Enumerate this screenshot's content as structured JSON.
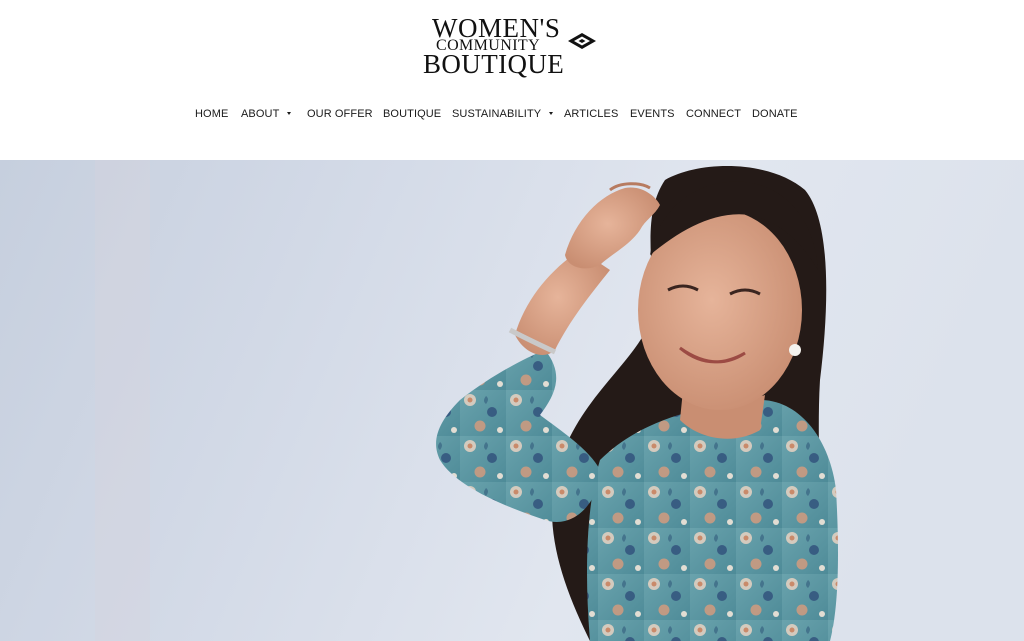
{
  "logo": {
    "line1": "WOMEN'S",
    "line2": "COMMUNITY",
    "line3": "BOUTIQUE",
    "icon": "diamond-logo-icon"
  },
  "nav": {
    "items": [
      {
        "label": "HOME",
        "has_dropdown": false
      },
      {
        "label": "ABOUT",
        "has_dropdown": true
      },
      {
        "label": "OUR OFFER",
        "has_dropdown": false
      },
      {
        "label": "BOUTIQUE",
        "has_dropdown": false
      },
      {
        "label": "SUSTAINABILITY",
        "has_dropdown": true
      },
      {
        "label": "ARTICLES",
        "has_dropdown": false
      },
      {
        "label": "EVENTS",
        "has_dropdown": false
      },
      {
        "label": "CONNECT",
        "has_dropdown": false
      },
      {
        "label": "DONATE",
        "has_dropdown": false
      }
    ]
  },
  "hero": {
    "icon": "hero-photo-smiling-woman"
  },
  "colors": {
    "text": "#1a1a1a",
    "background": "#ffffff",
    "hero_backdrop": "#dde3ee",
    "blouse": "#5f9aa6"
  }
}
